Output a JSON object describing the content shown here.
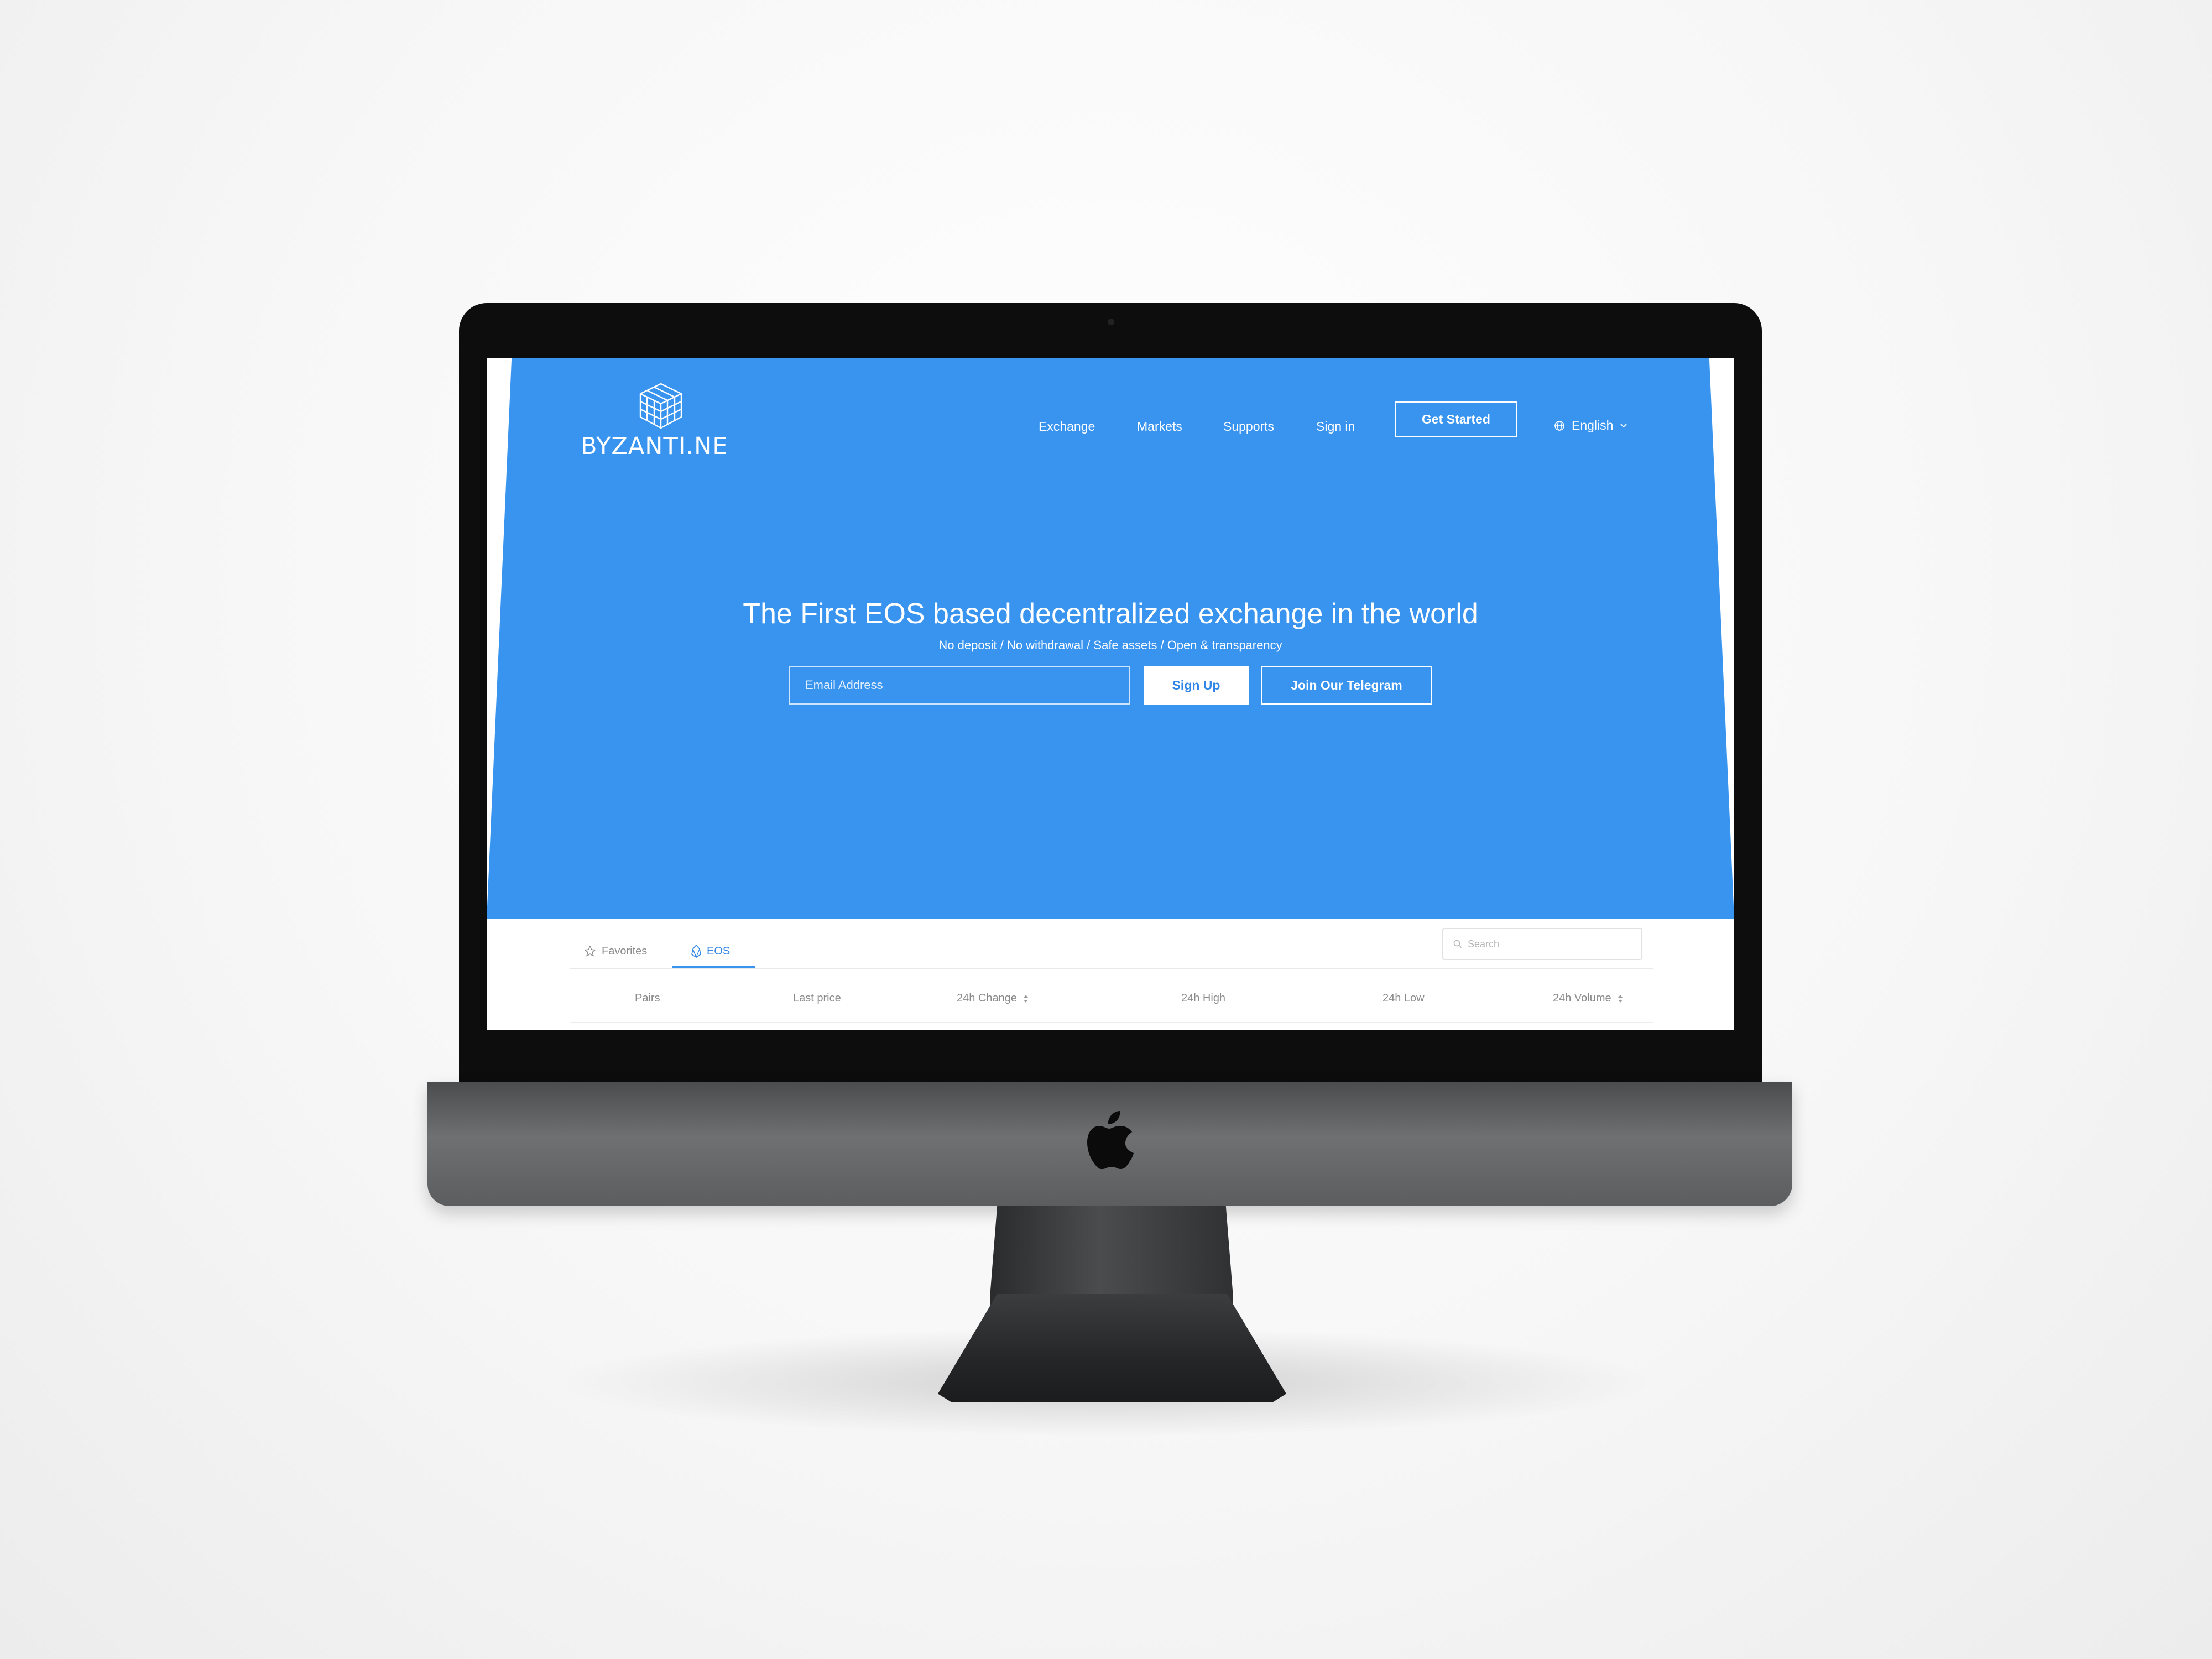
{
  "header": {
    "logo_text": "BYZANTI.NE",
    "nav": [
      "Exchange",
      "Markets",
      "Supports",
      "Sign in"
    ],
    "cta_label": "Get Started",
    "language": "English"
  },
  "hero": {
    "headline": "The First EOS based decentralized exchange in the world",
    "subline": "No deposit / No withdrawal / Safe assets / Open & transparency",
    "email_placeholder": "Email Address",
    "signup_label": "Sign Up",
    "telegram_label": "Join Our Telegram"
  },
  "markets": {
    "tabs": [
      "Favorites",
      "EOS"
    ],
    "active_tab": "EOS",
    "search_placeholder": "Search",
    "columns": [
      "Pairs",
      "Last price",
      "24h Change",
      "24h High",
      "24h Low",
      "24h Volume"
    ]
  },
  "colors": {
    "accent": "#3994f0",
    "accent_text": "#2f86e6",
    "bezel": "#0d0d0d",
    "chin": "#6e7072"
  },
  "icons": {
    "logo": "cube-stack-icon",
    "language": "globe-icon",
    "dropdown": "chevron-down-icon",
    "favorites": "star-icon",
    "eos": "eos-icon",
    "search": "search-icon",
    "sort": "sort-icon",
    "brand": "apple-icon"
  }
}
